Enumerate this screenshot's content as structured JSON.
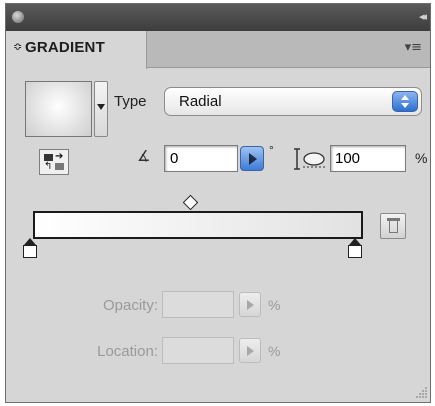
{
  "window": {
    "collapse_glyph": "◂◂"
  },
  "tab": {
    "arrows": "≎",
    "label": "GRADIENT",
    "menu_glyph": "▾≡"
  },
  "type": {
    "label": "Type",
    "value": "Radial"
  },
  "angle": {
    "value": "0",
    "degree": "°"
  },
  "aspect": {
    "value": "100",
    "unit": "%"
  },
  "opacity": {
    "label": "Opacity:",
    "value": "",
    "unit": "%"
  },
  "location": {
    "label": "Location:",
    "value": "",
    "unit": "%"
  },
  "icons": {
    "swatch": "gradient-fill-swatch",
    "reverse": "reverse-gradient-icon",
    "angle": "angle-icon",
    "aspect": "aspect-ratio-icon",
    "delete": "trash-icon"
  },
  "colors": {
    "accent": "#3d7bd6",
    "panel": "#d6d6d6",
    "title_bar": "#4a4a4a",
    "disabled_text": "#9a9a9a"
  }
}
